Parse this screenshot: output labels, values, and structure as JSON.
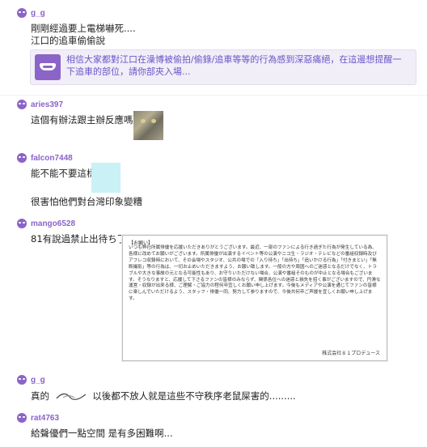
{
  "posts": [
    {
      "author": "g_g",
      "lines": [
        "剛剛經過要上電梯嚇死....",
        "江口的追車偷偷說"
      ]
    },
    {
      "author": "aries397",
      "lines": [
        "這個有辦法跟主辦反應嗎..."
      ]
    },
    {
      "author": "falcon7448",
      "lines": [
        "能不能不要這樣",
        "很害怕他們對台灣印象變糟"
      ]
    },
    {
      "author": "mango6528",
      "lines": [
        "81有說過禁止出待ち了"
      ]
    },
    {
      "author": "g_g",
      "lines": [
        "真的",
        "以後都不放人就是這些不守秩序老鼠屎害的........."
      ]
    },
    {
      "author": "rat4763",
      "lines": [
        "給聲優們一點空間 是有多困難啊..."
      ]
    }
  ],
  "link_card": {
    "icon": "mask-icon",
    "text": "相信大家都對江口在澡博被偷拍/偷錄/追車等等的行為感到深惡痛絕，在這邊想提醒一下追車的部位，請你部夾入場..."
  },
  "notice": {
    "title": "【お願い】",
    "body": "いつも弊社所属俳優を応援いただきありがとうございます。最近、一部のファンによる行き過ぎた行為が発生している為、各様に改めてお願いがございます。所属俳優が出演するイベント等の公演やニコ生・ラジオ・テレビなどの番組収録時及びアフレコ収録時において、その会場やスタジオ、公共の場での「入り待ち」「出待ち」「追いかける行為」「付きまとい」「無断撮影」等の行為は、一切お止めいただきますよう、お願い致します。一般の方や周囲へのご迷惑となるだけでなく、トラブルや大きな事故の元となる可能性もあり、お守りいただけない場合、公演や番組そのものが中止となる場合もございます。そうなりますと、応援して下さるファンの皆様のみならず、関係各位への迷惑と損失を招く事がございますので、円滑な運営・収録が出来る様、ご理解・ご協力の程何卒宜しくお願い申し上げます。今後もメディアや公演を通じてファンの皆様に楽しんでいただけるよう、スタッフ・俳優一同、努力して参りますので、今後共何卒ご声援を宜しくお願い申し上げます。",
    "signature": "株式会社８１プロデュース"
  },
  "colors": {
    "accent": "#8b64c8",
    "link": "#6b55c8",
    "card_bg": "#f1eef8"
  }
}
